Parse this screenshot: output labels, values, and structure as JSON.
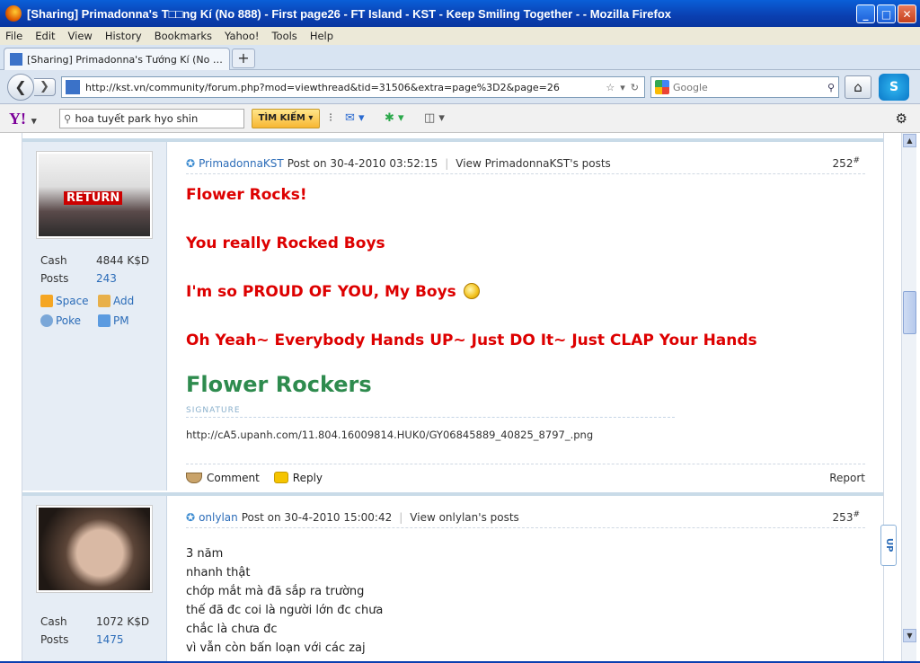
{
  "window": {
    "title": "[Sharing] Primadonna's T□□ng Kí (No 888) - First page26 - FT Island - KST - Keep Smiling Together - - Mozilla Firefox",
    "min": "_",
    "max": "□",
    "close": "✕"
  },
  "menu": [
    "File",
    "Edit",
    "View",
    "History",
    "Bookmarks",
    "Yahoo!",
    "Tools",
    "Help"
  ],
  "tab": {
    "label": "[Sharing] Primadonna's Tướng Kí (No 888) - ...",
    "new_tab": "+"
  },
  "nav": {
    "url": "http://kst.vn/community/forum.php?mod=viewthread&tid=31506&extra=page%3D2&page=26",
    "search_placeholder": "Google"
  },
  "yahoo": {
    "search_value": "hoa tuyết park hyo shin",
    "search_button": "TÌM KIẾM"
  },
  "posts": [
    {
      "author": "PrimadonnaKST",
      "time": "Post on 30-4-2010 03:52:15",
      "view": "View PrimadonnaKST's posts",
      "number": "252",
      "cash_label": "Cash",
      "cash": "4844 K$D",
      "posts_label": "Posts",
      "posts": "243",
      "space": "Space",
      "add": "Add",
      "poke": "Poke",
      "pm": "PM",
      "avatar_text": "RETURN",
      "lines": [
        "Flower Rocks!",
        "You really Rocked Boys",
        "I'm so PROUD OF YOU, My Boys",
        "Oh Yeah~ Everybody Hands UP~ Just DO It~ Just CLAP Your Hands"
      ],
      "sig_name": "Flower Rockers",
      "sig_label": "SIGNATURE",
      "sig_url": "http://cA5.upanh.com/11.804.16009814.HUK0/GY06845889_40825_8797_.png",
      "comment": "Comment",
      "reply": "Reply",
      "report": "Report"
    },
    {
      "author": "onlylan",
      "time": "Post on 30-4-2010 15:00:42",
      "view": "View onlylan's posts",
      "number": "253",
      "cash_label": "Cash",
      "cash": "1072 K$D",
      "posts_label": "Posts",
      "posts": "1475",
      "lines": [
        "3 năm",
        "nhanh thật",
        "chớp mắt mà đã sắp ra trường",
        "thế đã đc coi là người lớn đc chưa",
        "chắc là chưa đc",
        "vì vẫn còn bấn loạn với các zaj"
      ]
    }
  ],
  "up_button": "UP"
}
